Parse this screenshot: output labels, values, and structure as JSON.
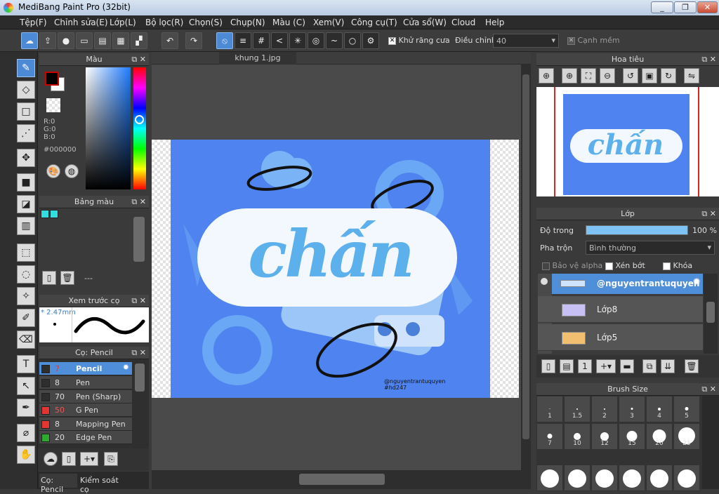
{
  "window": {
    "title": "MediBang Paint Pro (32bit)",
    "minimize": "_",
    "maximize": "❐",
    "close": "✕"
  },
  "menu": [
    "Tệp(F)",
    "Chỉnh sửa(E)",
    "Lớp(L)",
    "Bộ lọc(R)",
    "Chọn(S)",
    "Chụp(N)",
    "Màu (C)",
    "Xem(V)",
    "Công cụ(T)",
    "Cửa sổ(W)",
    "Cloud",
    "Help"
  ],
  "toolbar": {
    "antialias_label": "Khử răng cưa",
    "adjust_label": "Điều chỉnh",
    "adjust_value": "40",
    "soft_edge_label": "Cạnh mềm"
  },
  "color_panel": {
    "title": "Màu",
    "r": "R:0",
    "g": "G:0",
    "b": "B:0",
    "hex": "#000000",
    "fg": "#000000",
    "bg": "#ffffff"
  },
  "palette_panel": {
    "title": "Bảng màu",
    "swatches": [
      "#33dddd",
      "#33dddd"
    ],
    "name_value": "---"
  },
  "preview_panel": {
    "title": "Xem trước cọ",
    "size": "* 2.47mm"
  },
  "brush_panel": {
    "title": "Cọ: Pencil",
    "items": [
      {
        "size": "7",
        "name": "Pencil",
        "color": "#2e2e2e",
        "selected": true
      },
      {
        "size": "8",
        "name": "Pen",
        "color": "#2e2e2e",
        "selected": false
      },
      {
        "size": "70",
        "name": "Pen (Sharp)",
        "color": "#2e2e2e",
        "selected": false
      },
      {
        "size": "50",
        "name": "G Pen",
        "color": "#e53434",
        "selected": false
      },
      {
        "size": "8",
        "name": "Mapping Pen",
        "color": "#e53434",
        "selected": false
      },
      {
        "size": "20",
        "name": "Edge Pen",
        "color": "#2eaa2e",
        "selected": false
      }
    ],
    "tab1": "Cọ: Pencil",
    "tab2": "Kiểm soát cọ"
  },
  "document": {
    "tab": "khung 1.jpg",
    "artwork_text": "chấn",
    "watermark_line1": "@nguyentrantuquyen",
    "watermark_line2": "#hd247"
  },
  "navigator": {
    "title": "Hoa tiêu"
  },
  "layer_panel": {
    "title": "Lớp",
    "opacity_label": "Độ trong",
    "opacity_value": "100 %",
    "opacity_fraction": 1.0,
    "blend_label": "Pha trộn",
    "blend_value": "Bình thường",
    "protect_alpha": "Bảo vệ alpha",
    "clipping": "Xén bớt",
    "lock": "Khóa",
    "layers": [
      {
        "name": "@nguyentrantuquyen",
        "selected": true
      },
      {
        "name": "Lớp8",
        "selected": false
      },
      {
        "name": "Lớp5",
        "selected": false
      }
    ]
  },
  "brush_size_panel": {
    "title": "Brush Size",
    "sizes": [
      "1",
      "1.5",
      "2",
      "3",
      "4",
      "5",
      "7",
      "10",
      "12",
      "15",
      "20",
      "25"
    ]
  }
}
